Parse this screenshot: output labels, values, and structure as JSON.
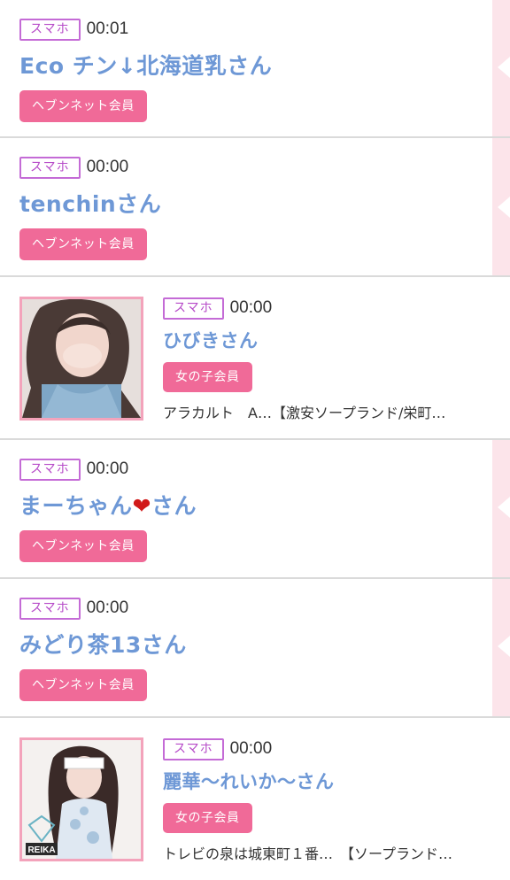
{
  "feed": {
    "rows": [
      {
        "badge": "スマホ",
        "time": "00:01",
        "name": "Eco チン↓北海道乳さん",
        "member": "ヘブンネット会員"
      },
      {
        "badge": "スマホ",
        "time": "00:00",
        "name": "tenchinさん",
        "member": "ヘブンネット会員"
      },
      {
        "badge": "スマホ",
        "time": "00:00",
        "name": "ひびきさん",
        "member": "女の子会員",
        "shop": "アラカルト　A…【激安ソープランド/栄町…"
      },
      {
        "badge": "スマホ",
        "time": "00:00",
        "name_prefix": "まーちゃん",
        "name_heart": "❤",
        "name_suffix": "さん",
        "member": "ヘブンネット会員"
      },
      {
        "badge": "スマホ",
        "time": "00:00",
        "name": "みどり茶13さん",
        "member": "ヘブンネット会員"
      },
      {
        "badge": "スマホ",
        "time": "00:00",
        "name": "麗華〜れいか〜さん",
        "member": "女の子会員",
        "shop": "トレビの泉は城東町１番…　【ソープランド…",
        "watermark": "REIKA"
      }
    ]
  },
  "colors": {
    "name": "#6e98d6",
    "badge_border": "#c46bd6",
    "member_bg": "#f06a98",
    "side_strip": "#fce4ea"
  }
}
